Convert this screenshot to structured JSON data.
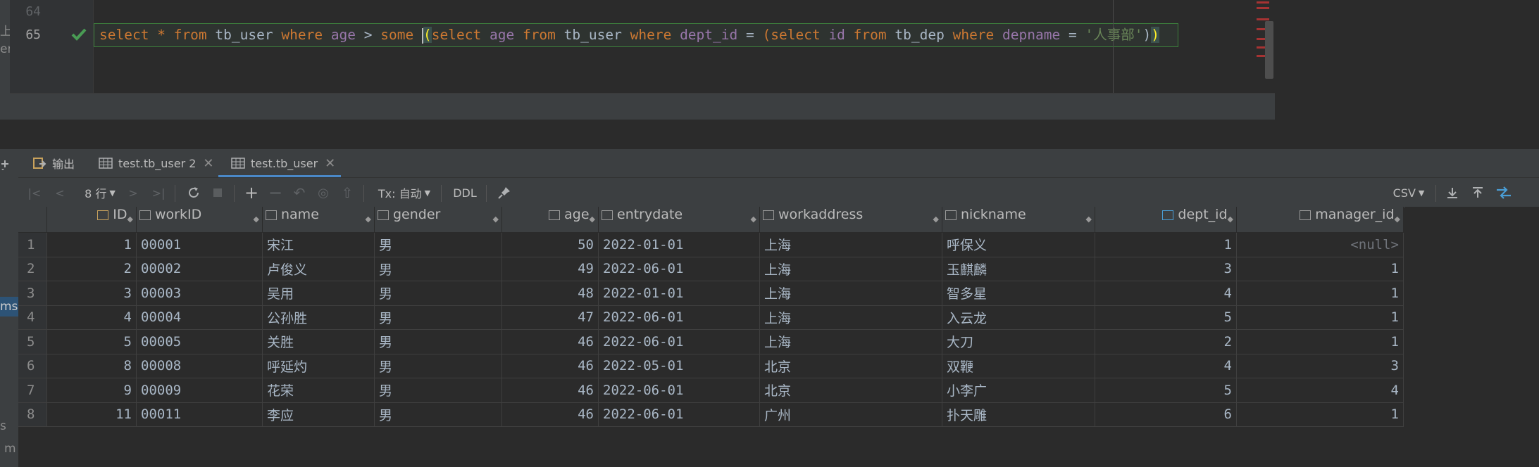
{
  "editor": {
    "left_strip": [
      "上",
      "er"
    ],
    "lines": [
      {
        "number": "64"
      },
      {
        "number": "65"
      }
    ],
    "sql": {
      "t1": "select",
      "t2": "*",
      "t3": "from",
      "t4": "tb_user",
      "t5": "where",
      "t6": "age",
      "t7": ">",
      "t8": "some",
      "t9": "(",
      "t10": "select",
      "t11": "age",
      "t12": "from",
      "t13": "tb_user",
      "t14": "where",
      "t15": "dept_id",
      "t16": "=",
      "t17": "(select",
      "t18": "id",
      "t19": "from",
      "t20": "tb_dep",
      "t21": "where",
      "t22": "depname",
      "t23": "=",
      "t24": "'人事部'",
      "t25": ")",
      "t26": ")"
    }
  },
  "side": {
    "ms": "ms",
    "s": "s",
    "m": "m"
  },
  "tabs": [
    {
      "label": "输出",
      "icon": "output-icon"
    },
    {
      "label": "test.tb_user 2",
      "icon": "table-icon"
    },
    {
      "label": "test.tb_user",
      "icon": "table-icon",
      "active": true
    }
  ],
  "toolbar": {
    "rows_label": "8 行",
    "tx_label": "Tx: 自动",
    "ddl_label": "DDL",
    "export_format": "CSV"
  },
  "grid": {
    "columns": [
      "ID",
      "workID",
      "name",
      "gender",
      "age",
      "entrydate",
      "workaddress",
      "nickname",
      "dept_id",
      "manager_id"
    ],
    "rows": [
      {
        "rn": "1",
        "cells": [
          "1",
          "00001",
          "宋江",
          "男",
          "50",
          "2022-01-01",
          "上海",
          "呼保义",
          "1",
          "<null>"
        ]
      },
      {
        "rn": "2",
        "cells": [
          "2",
          "00002",
          "卢俊义",
          "男",
          "49",
          "2022-06-01",
          "上海",
          "玉麒麟",
          "3",
          "1"
        ]
      },
      {
        "rn": "3",
        "cells": [
          "3",
          "00003",
          "吴用",
          "男",
          "48",
          "2022-01-01",
          "上海",
          "智多星",
          "4",
          "1"
        ]
      },
      {
        "rn": "4",
        "cells": [
          "4",
          "00004",
          "公孙胜",
          "男",
          "47",
          "2022-06-01",
          "上海",
          "入云龙",
          "5",
          "1"
        ]
      },
      {
        "rn": "5",
        "cells": [
          "5",
          "00005",
          "关胜",
          "男",
          "46",
          "2022-06-01",
          "上海",
          "大刀",
          "2",
          "1"
        ]
      },
      {
        "rn": "6",
        "cells": [
          "8",
          "00008",
          "呼延灼",
          "男",
          "46",
          "2022-05-01",
          "北京",
          "双鞭",
          "4",
          "3"
        ]
      },
      {
        "rn": "7",
        "cells": [
          "9",
          "00009",
          "花荣",
          "男",
          "46",
          "2022-06-01",
          "北京",
          "小李广",
          "5",
          "4"
        ]
      },
      {
        "rn": "8",
        "cells": [
          "11",
          "00011",
          "李应",
          "男",
          "46",
          "2022-06-01",
          "广州",
          "扑天雕",
          "6",
          "1"
        ]
      }
    ]
  }
}
